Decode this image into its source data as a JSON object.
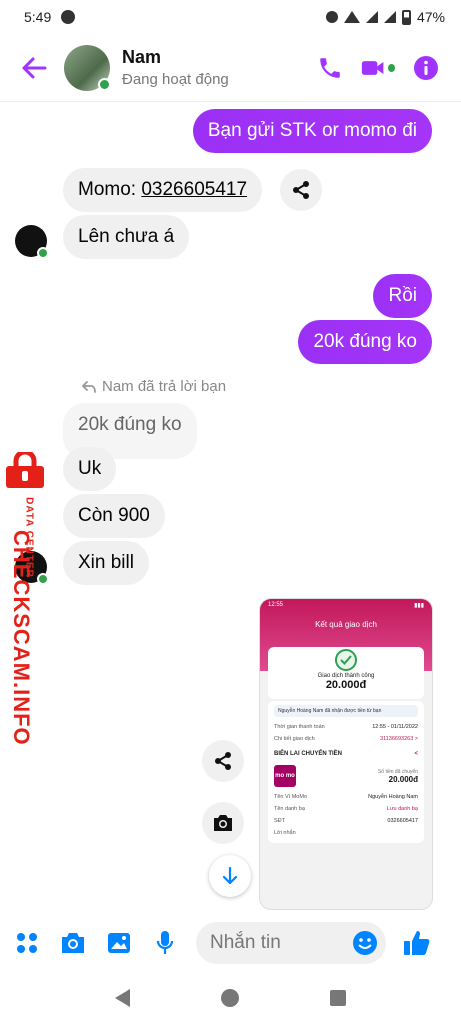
{
  "status_bar": {
    "time": "5:49",
    "battery": "47%"
  },
  "header": {
    "name": "Nam",
    "status": "Đang hoạt động"
  },
  "colors": {
    "accent": "#a033ff",
    "online": "#31a24c",
    "watermark": "#e32119"
  },
  "messages": [
    {
      "id": "m1",
      "side": "out",
      "text": "Bạn gửi STK or momo đi"
    },
    {
      "id": "m2",
      "side": "in",
      "prefix": "Momo: ",
      "number": "0326605417"
    },
    {
      "id": "m3",
      "side": "in",
      "text": "Lên chưa á"
    },
    {
      "id": "m4",
      "side": "out",
      "text": "Rồi"
    },
    {
      "id": "m5",
      "side": "out",
      "text": "20k đúng ko"
    },
    {
      "id": "m6",
      "side": "in",
      "text": "20k đúng ko",
      "quoted": true
    },
    {
      "id": "m7",
      "side": "in",
      "text": "Uk"
    },
    {
      "id": "m8",
      "side": "in",
      "text": "Còn 900"
    },
    {
      "id": "m9",
      "side": "in",
      "text": "Xin bill"
    }
  ],
  "reply_note": "Nam đã trả lời bạn",
  "watermark": {
    "main": "CHECKSCAM.INFO",
    "sub": "DATA CENTER"
  },
  "receipt": {
    "status_time": "12:55",
    "title": "Kết quả giao dịch",
    "success": "Giao dịch thành công",
    "amount": "20.000đ",
    "note": "Nguyễn Hoàng Nam đã nhận được tiền từ bạn",
    "rows": [
      {
        "label": "Thời gian thanh toán",
        "value": "12:55 - 01/11/2022"
      },
      {
        "label": "Chi tiết giao dịch",
        "value": "31136693263 >"
      }
    ],
    "section": "BIÊN LAI CHUYỂN TIỀN",
    "logo": "mo mo",
    "sent_label": "Số tiền đã chuyển",
    "sent_amount": "20.000đ",
    "detail_rows": [
      {
        "label": "Tên Ví MoMo",
        "value": "Nguyễn Hoàng Nam"
      },
      {
        "label": "Tên danh bạ",
        "value": "Lưu danh bạ"
      },
      {
        "label": "SĐT",
        "value": "0326605417"
      }
    ],
    "footer": "Lời nhắn"
  },
  "composer": {
    "placeholder": "Nhắn tin"
  }
}
